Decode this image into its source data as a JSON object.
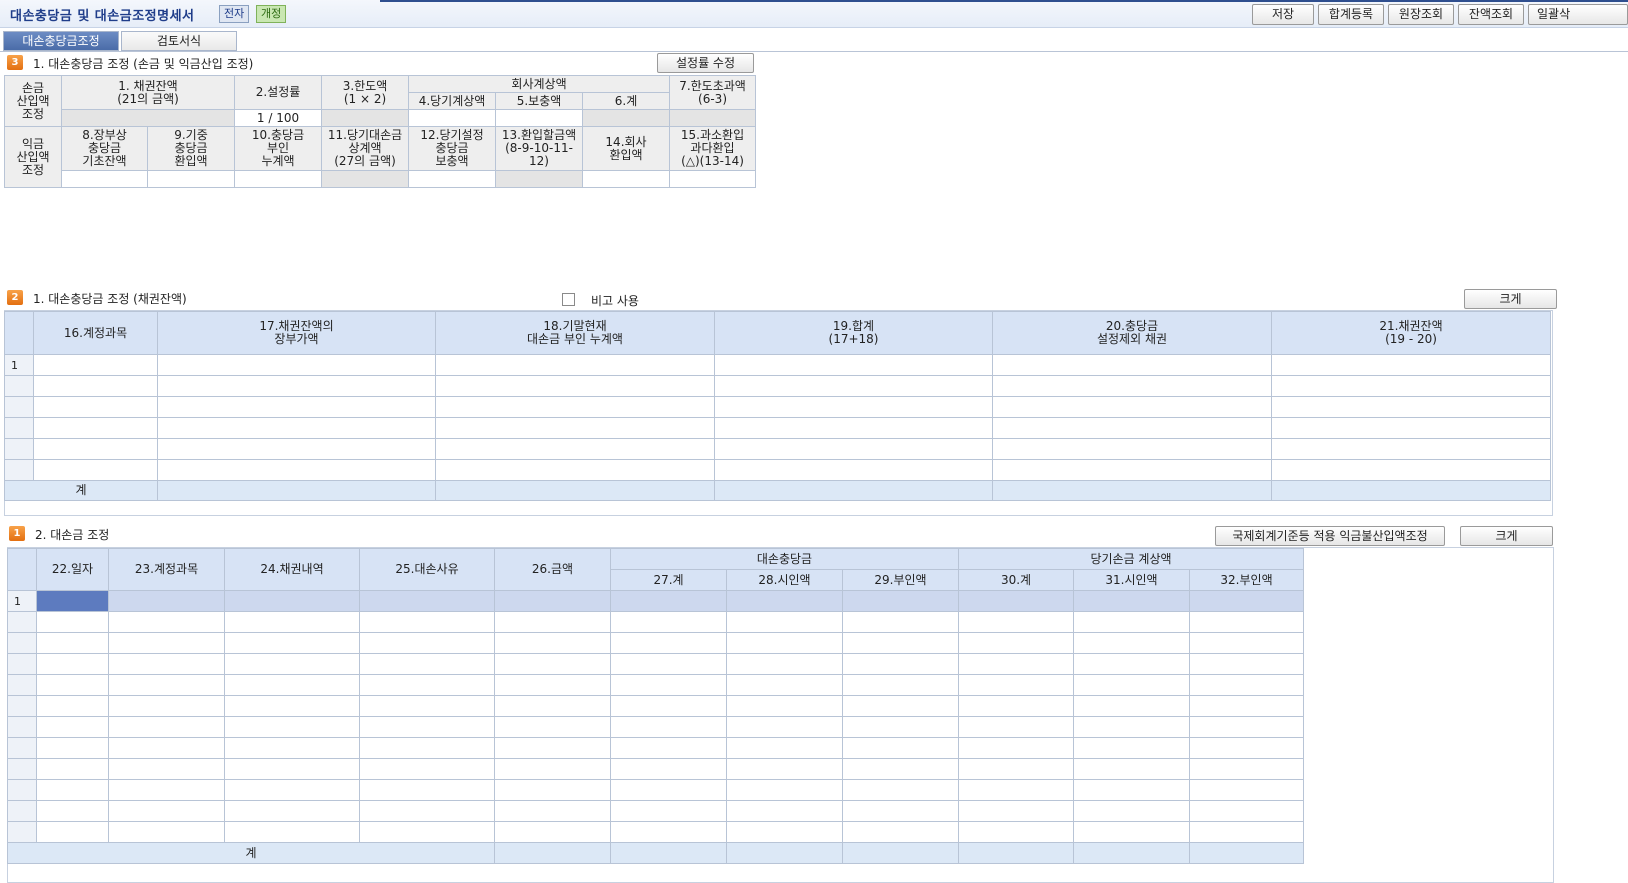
{
  "header": {
    "title": "대손충당금 및 대손금조정명세서",
    "badge_a": "전자",
    "badge_b": "개정",
    "buttons": [
      "저장",
      "합계등록",
      "원장조회",
      "잔액조회",
      "일괄삭"
    ]
  },
  "tabs": [
    "대손충당금조정",
    "검토서식"
  ],
  "section1": {
    "num": "3",
    "title": "1. 대손충당금 조정 (손금 및 익금산입 조정)",
    "button": "설정률 수정",
    "row1_label": [
      "손금",
      "산입액",
      "조정"
    ],
    "col1": [
      "1. 채권잔액",
      "(21의 금액)"
    ],
    "col2": "2.설정률",
    "col3": [
      "3.한도액",
      "(1 × 2)"
    ],
    "group": "회사계상액",
    "col4": "4.당기계상액",
    "col5": "5.보충액",
    "col6": "6.계",
    "col7": [
      "7.한도초과액",
      "(6-3)"
    ],
    "rate": "1 / 100",
    "row2_label": [
      "익금",
      "산입액",
      "조정"
    ],
    "col8": [
      "8.장부상",
      "충당금",
      "기초잔액"
    ],
    "col9": [
      "9.기중",
      "충당금",
      "환입액"
    ],
    "col10": [
      "10.충당금",
      "부인",
      "누계액"
    ],
    "col11": [
      "11.당기대손금",
      "상계액",
      "(27의 금액)"
    ],
    "col12": [
      "12.당기설정",
      "충당금",
      "보충액"
    ],
    "col13": [
      "13.환입할금액",
      "(8-9-10-11-12)"
    ],
    "col14": [
      "14.회사",
      "환입액"
    ],
    "col15": [
      "15.과소환입",
      "과다환입",
      "(△)(13-14)"
    ]
  },
  "section2": {
    "num": "2",
    "title": "1. 대손충당금 조정 (채권잔액)",
    "checkbox_label": "비고 사용",
    "button": "크게",
    "columns": [
      [
        "16.계정과목"
      ],
      [
        "17.채권잔액의",
        "장부가액"
      ],
      [
        "18.기말현재",
        "대손금 부인 누계액"
      ],
      [
        "19.합계",
        "(17+18)"
      ],
      [
        "20.충당금",
        "설정제외 채권"
      ],
      [
        "21.채권잔액",
        "(19 - 20)"
      ]
    ],
    "first_row": "1",
    "total": "계"
  },
  "section3": {
    "num": "1",
    "title": "2. 대손금 조정",
    "button_ifrs": "국제회계기준등 적용 익금불산입액조정",
    "button": "크게",
    "columns": [
      "22.일자",
      "23.계정과목",
      "24.채권내역",
      "25.대손사유",
      "26.금액"
    ],
    "group1": "대손충당금",
    "group1_cols": [
      "27.계",
      "28.시인액",
      "29.부인액"
    ],
    "group2": "당기손금 계상액",
    "group2_cols": [
      "30.계",
      "31.시인액",
      "32.부인액"
    ],
    "first_row": "1",
    "total": "계"
  }
}
